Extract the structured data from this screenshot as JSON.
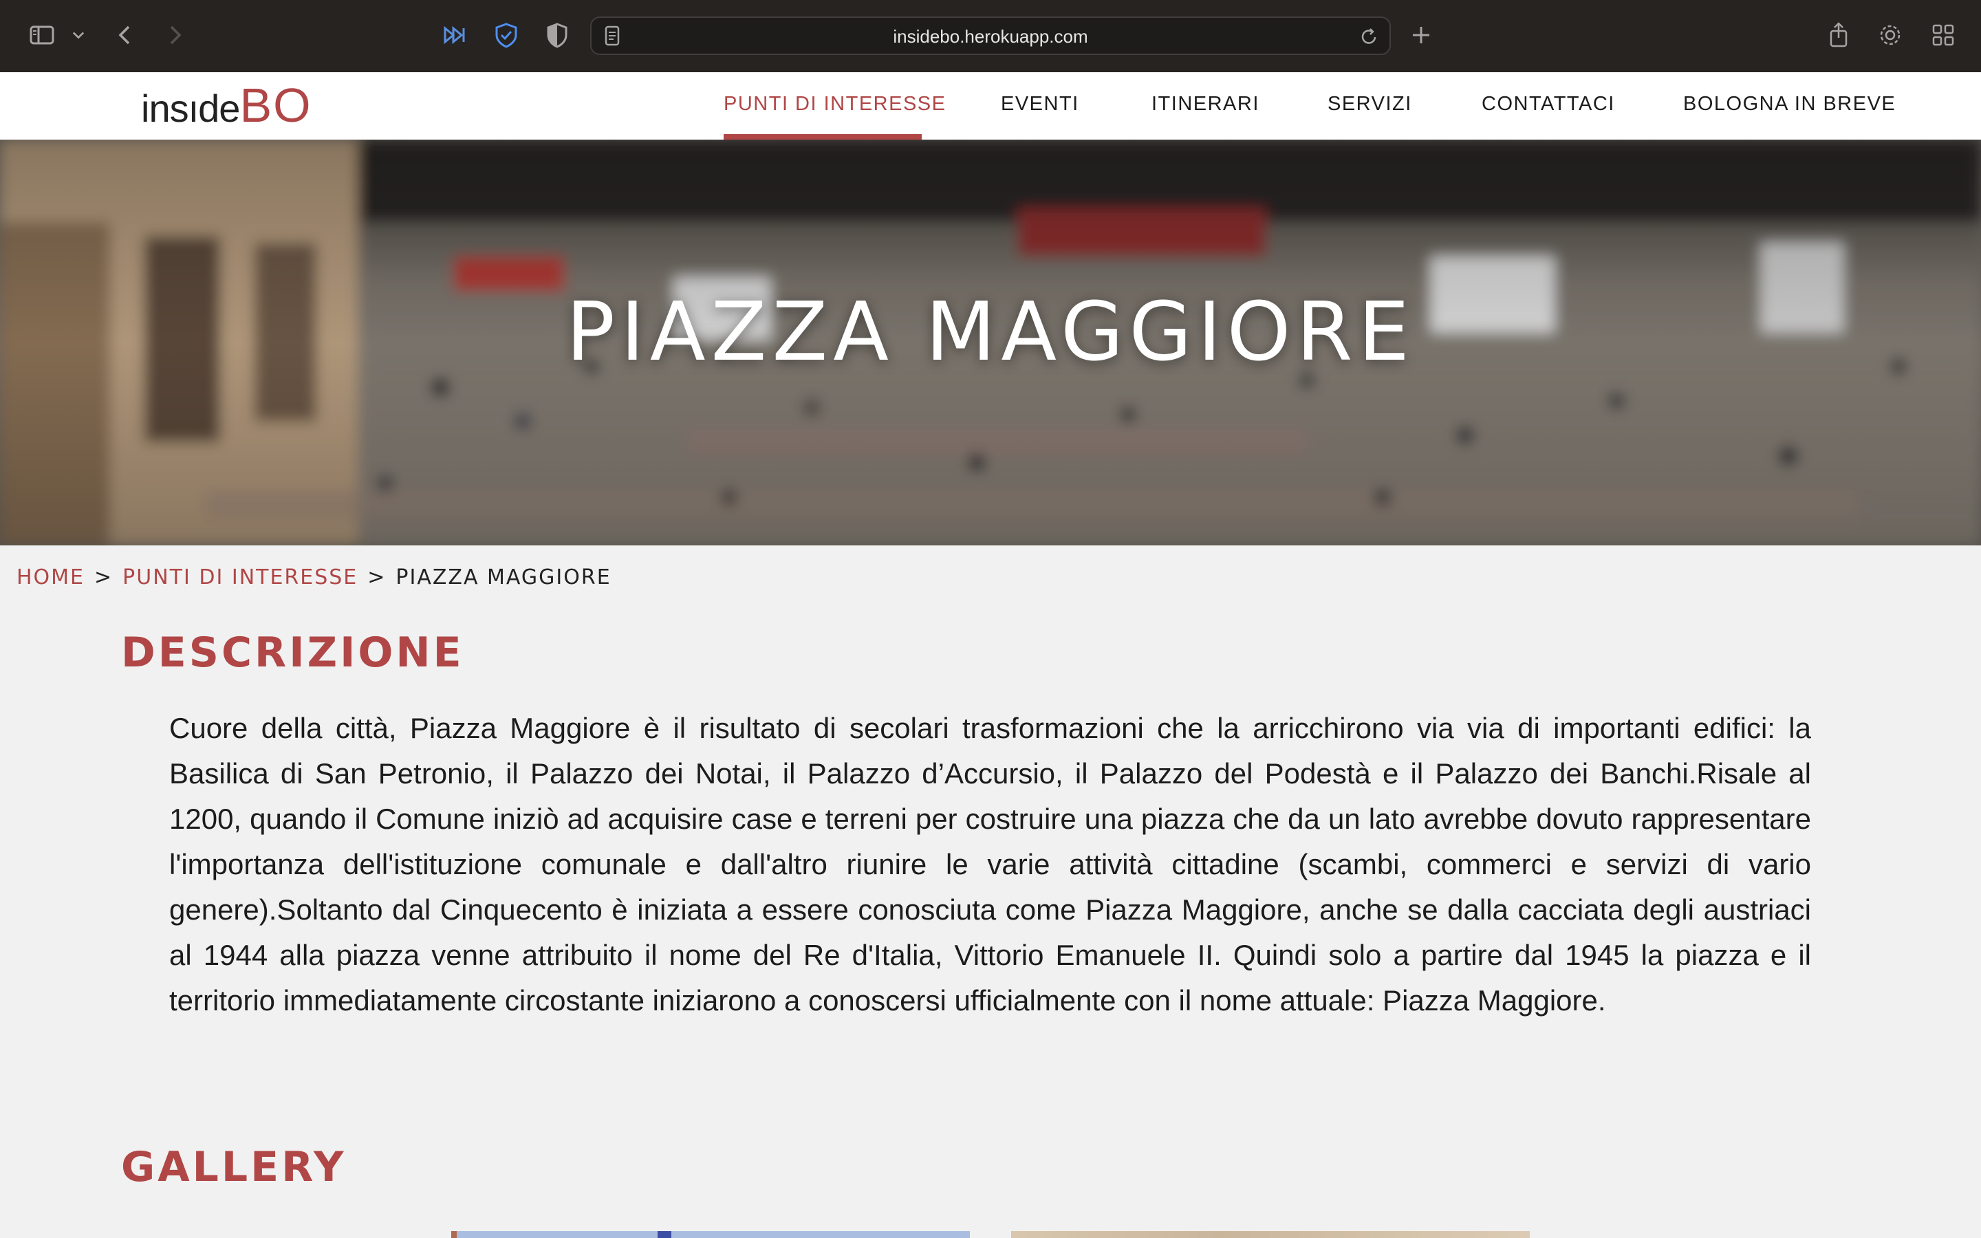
{
  "browser": {
    "url": "insidebo.herokuapp.com",
    "icons": [
      "sidebar-icon",
      "chevron-down-icon",
      "back-icon",
      "forward-icon",
      "extension-icon",
      "shield-icon",
      "privacy-icon",
      "page-icon",
      "reload-icon",
      "new-tab-icon",
      "share-icon",
      "gear-icon",
      "tab-overview-icon"
    ]
  },
  "site": {
    "logo_part1": "insıde",
    "logo_part2": "BO",
    "nav": [
      {
        "label": "PUNTI DI INTERESSE",
        "active": true
      },
      {
        "label": "EVENTI",
        "active": false
      },
      {
        "label": "ITINERARI",
        "active": false
      },
      {
        "label": "SERVIZI",
        "active": false
      },
      {
        "label": "CONTATTACI",
        "active": false
      },
      {
        "label": "BOLOGNA IN BREVE",
        "active": false
      }
    ],
    "accent_color": "#b04646"
  },
  "hero": {
    "title": "PIAZZA MAGGIORE"
  },
  "breadcrumb": {
    "home": "HOME",
    "sep": ">",
    "section": "PUNTI DI INTERESSE",
    "current": "PIAZZA MAGGIORE"
  },
  "main": {
    "description_heading": "DESCRIZIONE",
    "description_text": "Cuore della città, Piazza Maggiore è il risultato di secolari trasformazioni che la arricchirono via via di importanti edifici: la Basilica di San Petronio, il Palazzo dei Notai, il Palazzo d’Accursio, il Palazzo del Podestà e il Palazzo dei Banchi.Risale al 1200, quando il Comune iniziò ad acquisire case e terreni per costruire una piazza che da un lato avrebbe dovuto rappresentare l'importanza dell'istituzione comunale e dall'altro riunire le varie attività cittadine (scambi, commerci e servizi di vario genere).Soltanto dal Cinquecento è iniziata a essere conosciuta come Piazza Maggiore, anche se dalla cacciata degli austriaci al 1944 alla piazza venne attribuito il nome del Re d'Italia, Vittorio Emanuele II. Quindi solo a partire dal 1945 la piazza e il territorio immediatamente circostante iniziarono a conoscersi ufficialmente con il nome attuale: Piazza Maggiore.",
    "gallery_heading": "GALLERY"
  }
}
